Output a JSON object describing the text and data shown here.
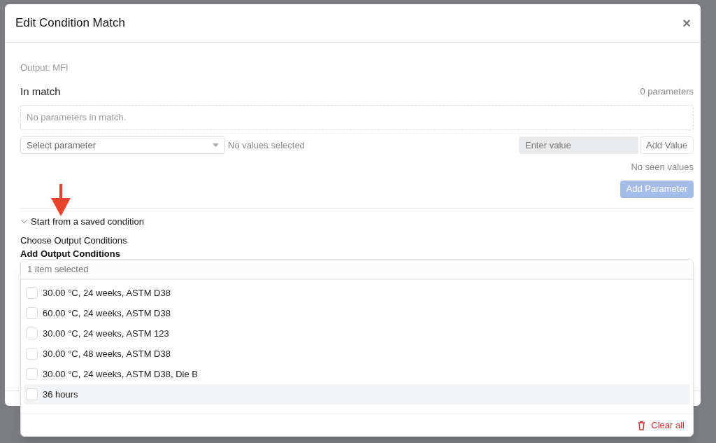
{
  "modal": {
    "title": "Edit Condition Match",
    "close": "×"
  },
  "output_label": "Output: MFI",
  "match": {
    "heading": "In match",
    "count": "0 parameters",
    "empty_text": "No parameters in match."
  },
  "parameter_select": {
    "placeholder": "Select parameter"
  },
  "values_status": "No values selected",
  "value_input": {
    "placeholder": "Enter value"
  },
  "add_value_button": "Add Value",
  "seen_values": "No seen values",
  "add_parameter_button": {
    "label": "Add Parameter",
    "disabled": true
  },
  "saved_condition": {
    "label": "Start from a saved condition",
    "expanded": true
  },
  "choose_label": "Choose Output Conditions",
  "add_label": "Add Output Conditions",
  "conditions_dropdown": {
    "summary": "1 item selected",
    "items": [
      {
        "label": "30.00 °C, 24 weeks, ASTM D38",
        "checked": false,
        "highlighted": false
      },
      {
        "label": "60.00 °C, 24 weeks, ASTM D38",
        "checked": false,
        "highlighted": false
      },
      {
        "label": "30.00 °C, 24 weeks, ASTM 123",
        "checked": false,
        "highlighted": false
      },
      {
        "label": "30.00 °C, 48 weeks, ASTM D38",
        "checked": false,
        "highlighted": false
      },
      {
        "label": "30.00 °C, 24 weeks, ASTM D38, Die B",
        "checked": false,
        "highlighted": false
      },
      {
        "label": "36 hours",
        "checked": false,
        "highlighted": true
      }
    ],
    "clear_all": "Clear all"
  }
}
